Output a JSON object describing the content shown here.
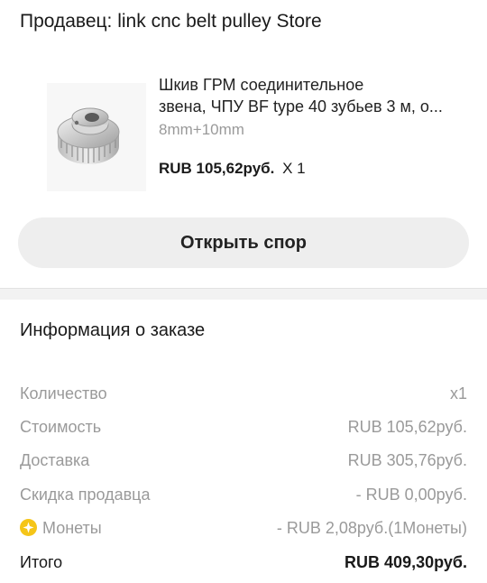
{
  "seller": {
    "label": "Продавец: link cnc belt pulley Store"
  },
  "product": {
    "title_line1": "Шкив ГРМ соединительное",
    "title_line2": "звена, ЧПУ BF type 40 зубьев 3 м, о...",
    "variant": "8mm+10mm",
    "price": "RUB 105,62руб.",
    "quantity": "X 1"
  },
  "dispute_button": {
    "label": "Открыть спор"
  },
  "order_info": {
    "title": "Информация о заказе",
    "rows": [
      {
        "label": "Количество",
        "value": "x1"
      },
      {
        "label": "Стоимость",
        "value": "RUB 105,62руб."
      },
      {
        "label": "Доставка",
        "value": "RUB 305,76руб."
      },
      {
        "label": "Скидка продавца",
        "value": "- RUB 0,00руб."
      },
      {
        "label": "Монеты",
        "value": "- RUB 2,08руб.(1Монеты)",
        "icon": "coin-icon"
      },
      {
        "label": "Итого",
        "value": "RUB 409,30руб."
      }
    ]
  },
  "colors": {
    "coin": "#f5c518",
    "muted_text": "#9a9a9a",
    "button_bg": "#eeeeee"
  }
}
